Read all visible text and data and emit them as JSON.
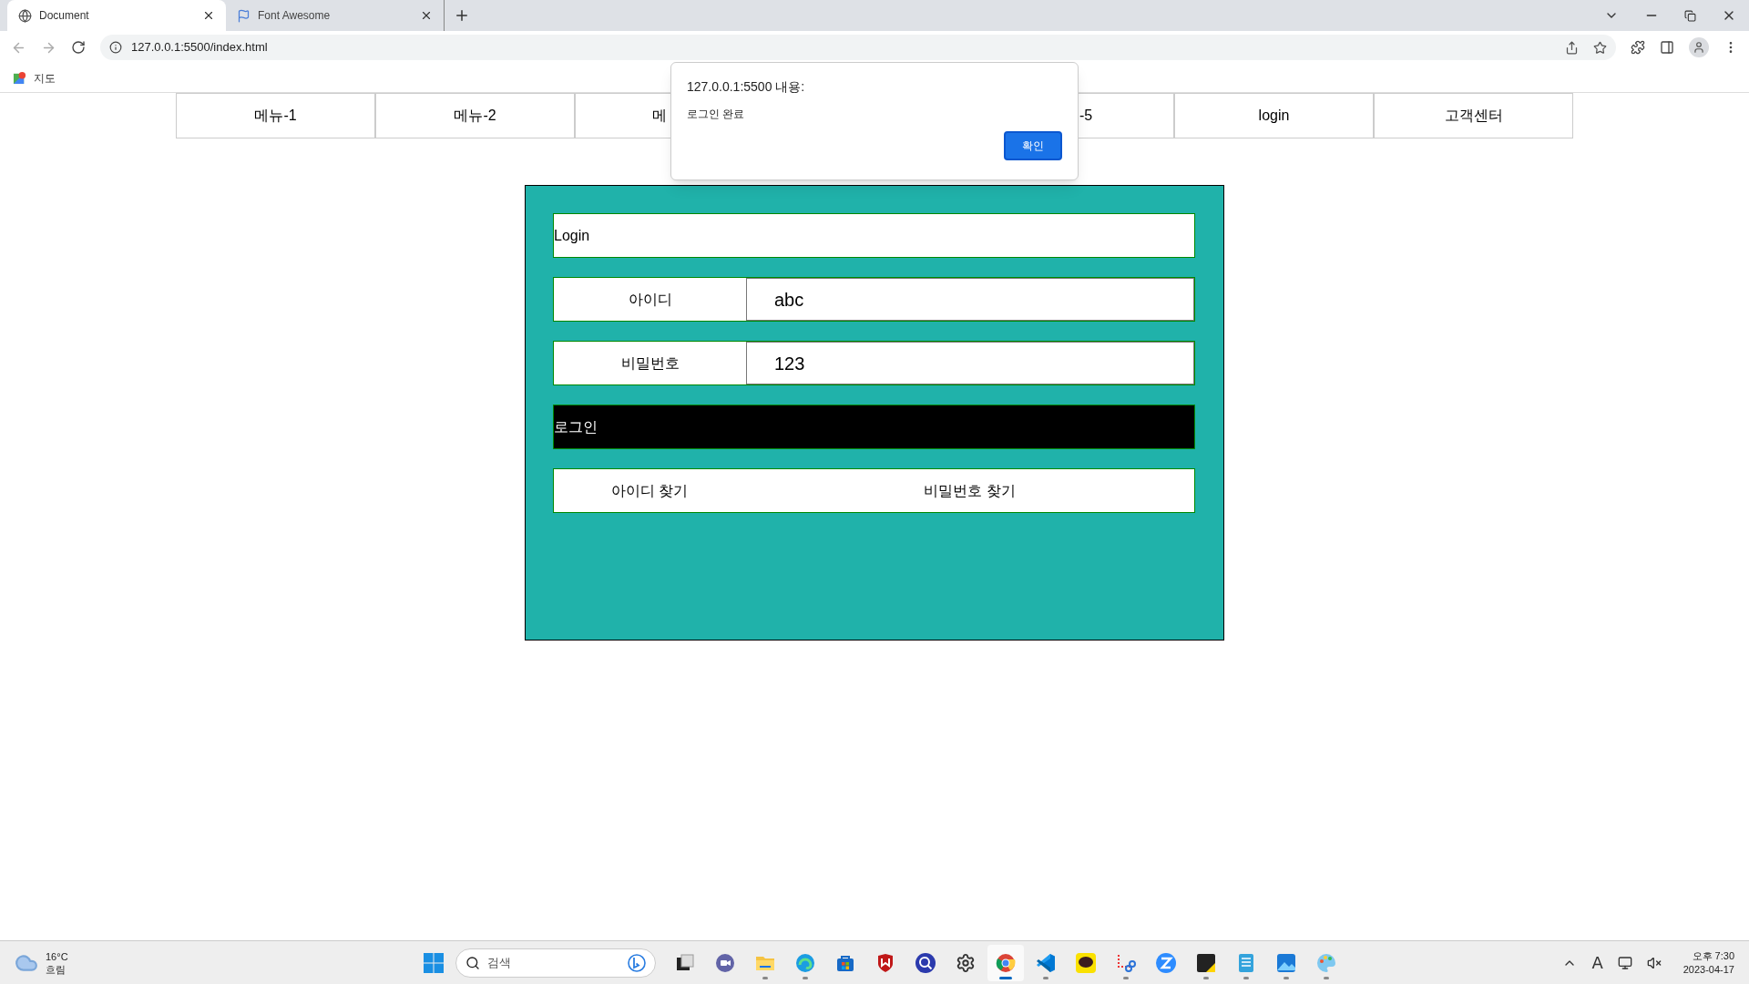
{
  "browser": {
    "tabs": [
      {
        "title": "Document",
        "kind": "globe",
        "selected": true
      },
      {
        "title": "Font Awesome",
        "kind": "flag",
        "selected": false
      }
    ],
    "address": "127.0.0.1:5500/index.html",
    "bookmarks": [
      {
        "label": "지도"
      }
    ]
  },
  "menu": [
    {
      "label": "메뉴-1",
      "kind": "full"
    },
    {
      "label": "메뉴-2",
      "kind": "full"
    },
    {
      "label": "메",
      "kind": "cut_right"
    },
    {
      "label": "-5",
      "kind": "cut_left"
    },
    {
      "label": "login",
      "kind": "full"
    },
    {
      "label": "고객센터",
      "kind": "full"
    }
  ],
  "login_panel": {
    "title": "Login",
    "fields": [
      {
        "label": "아이디",
        "value": "abc"
      },
      {
        "label": "비밀번호",
        "value": "123"
      }
    ],
    "submit": "로그인",
    "links": [
      "아이디 찾기",
      "비밀번호 찾기"
    ]
  },
  "alert": {
    "title": "127.0.0.1:5500 내용:",
    "message": "로그인 완료",
    "button": "확인"
  },
  "taskbar": {
    "weather": {
      "temp": "16°C",
      "condition": "흐림"
    },
    "search_placeholder": "검색",
    "apps": [
      {
        "kind": "taskview",
        "running": false,
        "selected": false
      },
      {
        "kind": "chat",
        "running": false,
        "selected": false
      },
      {
        "kind": "explorer",
        "running": true,
        "selected": false
      },
      {
        "kind": "edge",
        "running": true,
        "selected": false
      },
      {
        "kind": "store",
        "running": false,
        "selected": false
      },
      {
        "kind": "shield",
        "running": false,
        "selected": false
      },
      {
        "kind": "lens",
        "running": false,
        "selected": false
      },
      {
        "kind": "settings",
        "running": false,
        "selected": false
      },
      {
        "kind": "chrome",
        "running": true,
        "selected": true
      },
      {
        "kind": "vscode",
        "running": true,
        "selected": false
      },
      {
        "kind": "talk",
        "running": false,
        "selected": false
      },
      {
        "kind": "snip",
        "running": true,
        "selected": false
      },
      {
        "kind": "zoom",
        "running": false,
        "selected": false
      },
      {
        "kind": "sticky",
        "running": true,
        "selected": false
      },
      {
        "kind": "notepad",
        "running": true,
        "selected": false
      },
      {
        "kind": "photos",
        "running": true,
        "selected": false
      },
      {
        "kind": "paint",
        "running": true,
        "selected": false
      }
    ],
    "ime": "A",
    "time": "오후 7:30",
    "date": "2023-04-17"
  }
}
